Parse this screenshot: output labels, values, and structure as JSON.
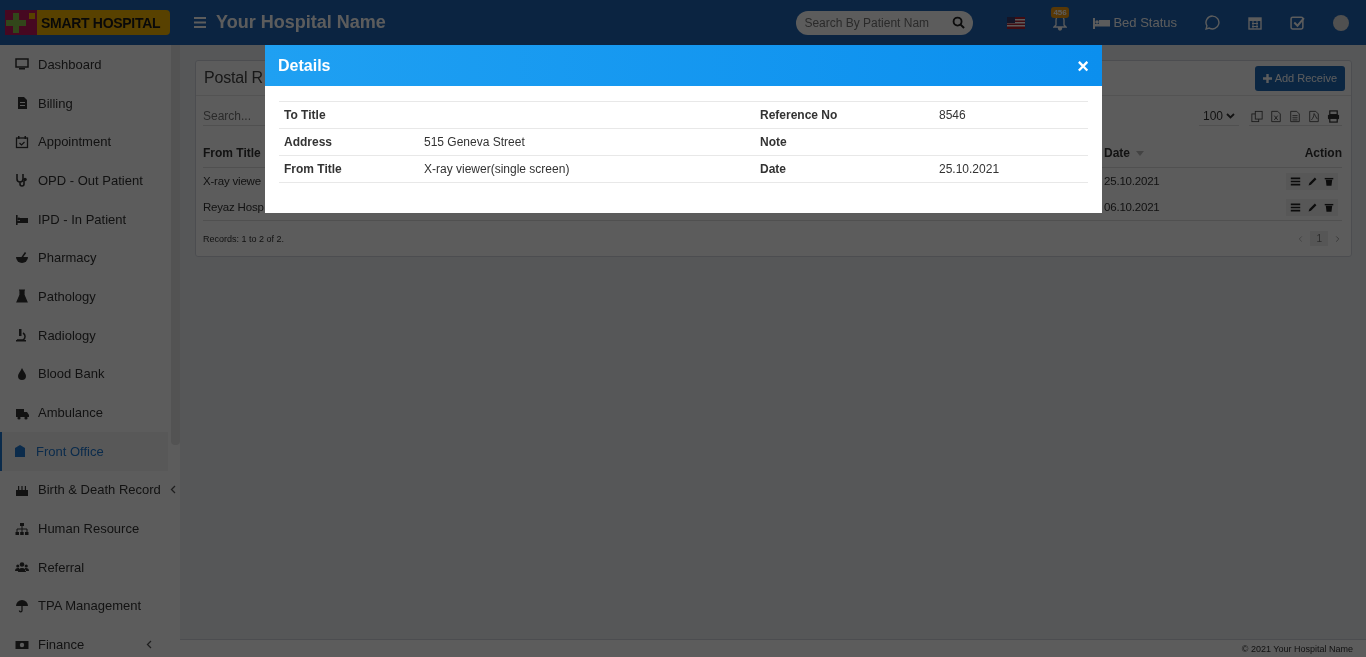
{
  "header": {
    "logo_text": "SMART HOSPITAL",
    "title": "Your Hospital Name",
    "search": {
      "placeholder": "Search By Patient Nam"
    },
    "notification_count": "456",
    "bed_status": "Bed Status"
  },
  "sidebar": {
    "items": [
      {
        "label": "Dashboard",
        "selected": false,
        "submenu": false
      },
      {
        "label": "Billing",
        "selected": false,
        "submenu": false
      },
      {
        "label": "Appointment",
        "selected": false,
        "submenu": false
      },
      {
        "label": "OPD - Out Patient",
        "selected": false,
        "submenu": false
      },
      {
        "label": "IPD - In Patient",
        "selected": false,
        "submenu": false
      },
      {
        "label": "Pharmacy",
        "selected": false,
        "submenu": false
      },
      {
        "label": "Pathology",
        "selected": false,
        "submenu": false
      },
      {
        "label": "Radiology",
        "selected": false,
        "submenu": false
      },
      {
        "label": "Blood Bank",
        "selected": false,
        "submenu": false
      },
      {
        "label": "Ambulance",
        "selected": false,
        "submenu": false
      },
      {
        "label": "Front Office",
        "selected": true,
        "submenu": false
      },
      {
        "label": "Birth & Death Record",
        "selected": false,
        "submenu": true
      },
      {
        "label": "Human Resource",
        "selected": false,
        "submenu": false
      },
      {
        "label": "Referral",
        "selected": false,
        "submenu": false
      },
      {
        "label": "TPA Management",
        "selected": false,
        "submenu": false
      },
      {
        "label": "Finance",
        "selected": false,
        "submenu": true
      }
    ]
  },
  "panel": {
    "title": "Postal R",
    "add_button": "Add Receive",
    "search": {
      "placeholder": "Search..."
    },
    "page_size": "100",
    "columns": [
      {
        "label": "From Title",
        "sort": false
      },
      {
        "label": "Date",
        "sort": true
      },
      {
        "label": "Action",
        "sort": false
      }
    ],
    "rows": [
      {
        "from_title": "X-ray viewe",
        "date": "25.10.2021"
      },
      {
        "from_title": "Reyaz Hosp",
        "date": "06.10.2021"
      }
    ],
    "records": "Records: 1 to 2 of 2.",
    "page": "1"
  },
  "modal": {
    "title": "Details",
    "close": "×",
    "rows": [
      {
        "label_1": "To Title",
        "label_2": "Reference No",
        "value_2": "8546"
      },
      {
        "label_1": "Address",
        "value_1": "515 Geneva Street",
        "label_2": "Note"
      },
      {
        "label_1": "From Title",
        "value_1": "X-ray viewer(single screen)",
        "label_2": "Date",
        "value_2": "25.10.2021"
      }
    ]
  },
  "footer": "© 2021 Your Hospital Name"
}
